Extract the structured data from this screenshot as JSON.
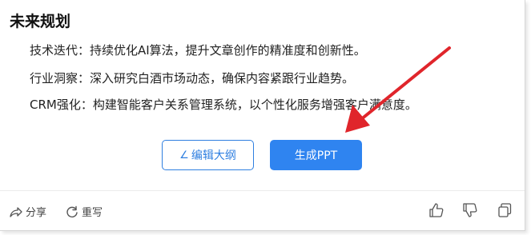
{
  "section": {
    "title": "未来规划",
    "items": [
      "技术迭代：持续优化AI算法，提升文章创作的精准度和创新性。",
      "行业洞察：深入研究白酒市场动态，确保内容紧跟行业趋势。",
      "CRM强化：构建智能客户关系管理系统，以个性化服务增强客户满意度。"
    ]
  },
  "buttons": {
    "edit_outline": "编辑大纲",
    "generate_ppt": "生成PPT"
  },
  "footer": {
    "share": "分享",
    "rewrite": "重写"
  },
  "icons": {
    "edit": "pen-icon",
    "share": "share-icon",
    "rewrite": "refresh-icon",
    "like": "thumbs-up-icon",
    "dislike": "thumbs-down-icon",
    "copy": "copy-icon"
  },
  "colors": {
    "accent": "#2f84f0",
    "annotation_arrow": "#e0252b"
  }
}
